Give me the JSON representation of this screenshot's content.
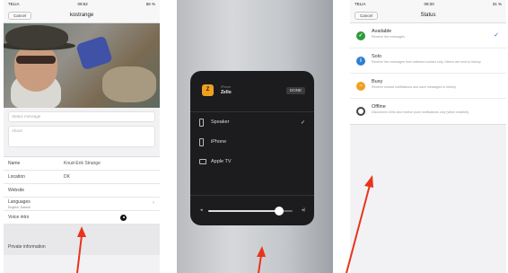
{
  "phone1": {
    "status": {
      "carrier": "TELIA",
      "time": "09:52",
      "battery": "56 %"
    },
    "nav": {
      "cancel": "Cancel",
      "title": "kostrange"
    },
    "status_message_placeholder": "Status message",
    "about_placeholder": "About",
    "rows": [
      {
        "label": "Name",
        "value": "Knud-Erik Strange"
      },
      {
        "label": "Location",
        "value": "DK"
      },
      {
        "label": "Website",
        "value": ""
      },
      {
        "label": "Languages",
        "value": "",
        "sub": "English, Danish"
      },
      {
        "label": "Voice intro",
        "value": ""
      }
    ],
    "section": "Private information"
  },
  "phone2": {
    "device_caption": "iPhone",
    "app_name": "Zello",
    "done": "DONE",
    "devices": [
      "Speaker",
      "iPhone",
      "Apple TV"
    ],
    "volume_level": 0.84
  },
  "phone3": {
    "status": {
      "carrier": "TELIA",
      "time": "09:20",
      "battery": "31 %"
    },
    "nav": {
      "cancel": "Cancel",
      "title": "Status"
    },
    "options": [
      {
        "title": "Available",
        "desc": "Receive live messages.",
        "color": "#2e9b3a",
        "icon": "check"
      },
      {
        "title": "Solo",
        "desc": "Receive live messages from selected contact only. Others are sent to history.",
        "color": "#2f7fd1",
        "icon": "info"
      },
      {
        "title": "Busy",
        "desc": "Receive unread notifications and save messages to history.",
        "color": "#f0a020",
        "icon": "minus"
      },
      {
        "title": "Offline",
        "desc": "Disconnect Zello and receive push notifications only (when enabled).",
        "color": "#444444",
        "icon": "ring"
      }
    ]
  },
  "colors": {
    "arrow": "#e8341c",
    "accent": "#1e63d6"
  }
}
